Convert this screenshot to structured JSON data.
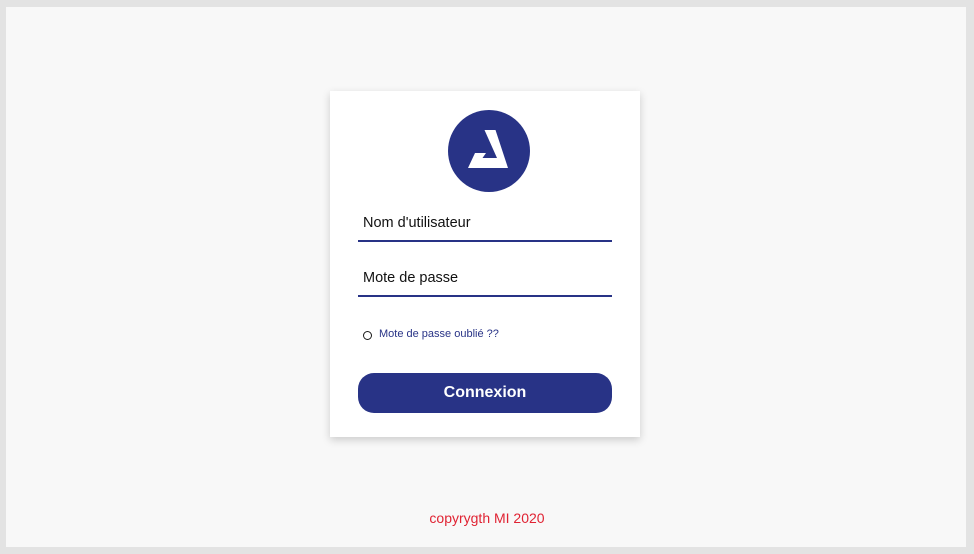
{
  "login": {
    "username_placeholder": "Nom d'utilisateur",
    "password_placeholder": "Mote de passe",
    "forgot_label": "Mote de passe oublié ??",
    "submit_label": "Connexion"
  },
  "footer": {
    "copyright": "copyrygth MI 2020"
  },
  "icons": {
    "logo": "triangle-a-logo-icon"
  },
  "colors": {
    "brand": "#283386",
    "background": "#f8f8f8",
    "footer_text": "#e02333"
  }
}
